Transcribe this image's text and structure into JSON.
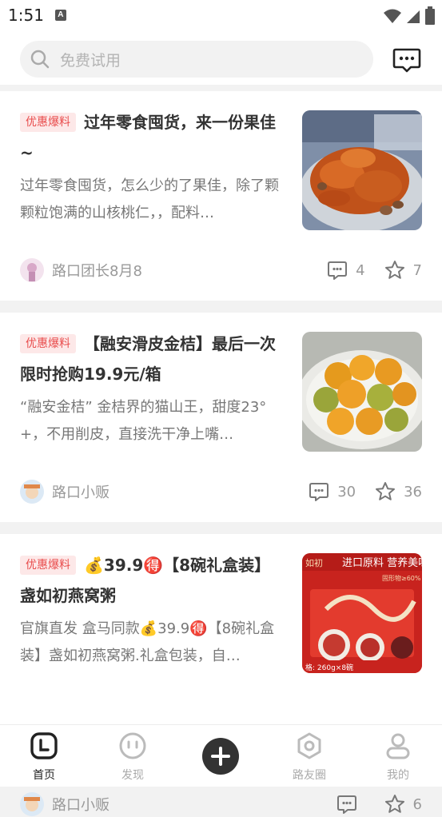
{
  "status_bar": {
    "time": "1:51",
    "notif_letter": "A"
  },
  "search": {
    "placeholder": "免费试用"
  },
  "feed": [
    {
      "tag": "优惠爆料",
      "title": "过年零食囤货，来一份果佳~",
      "desc": "过年零食囤货，怎么少的了果佳，除了颗颗粒饱满的山核桃仁，，配料…",
      "author": "路口团长8月8",
      "comments": "4",
      "likes": "7",
      "image": "dried-sweet-potato-snack-bowl"
    },
    {
      "tag": "优惠爆料",
      "title": "【融安滑皮金桔】最后一次限时抢购19.9元/箱",
      "desc": "“融安金桔” 金桔界的猫山王，甜度23°+，不用削皮，直接洗干净上嘴…",
      "author": "路口小贩",
      "comments": "30",
      "likes": "36",
      "image": "kumquats-on-plate"
    },
    {
      "tag": "优惠爆料",
      "title": "💰39.9🉐【8碗礼盒装】盏如初燕窝粥",
      "desc": "官旗直发 盒马同款💰39.9🉐【8碗礼盒装】盏如初燕窝粥.礼盒包装，自…",
      "author": "路口小贩",
      "comments": "",
      "likes": "6",
      "image": "bird-nest-congee-gift-box",
      "image_text": {
        "top": "进口原料 营养美味",
        "brand": "如初",
        "sub": "固形物≥60%",
        "bottom": "格: 260g×8碗"
      }
    }
  ],
  "tabbar": {
    "tabs": [
      {
        "label": "首页",
        "icon": "home-icon",
        "active": true
      },
      {
        "label": "发现",
        "icon": "discover-icon",
        "active": false
      },
      {
        "label": "路友圈",
        "icon": "circle-icon",
        "active": false
      },
      {
        "label": "我的",
        "icon": "profile-icon",
        "active": false
      }
    ]
  },
  "colors": {
    "accent": "#e94d4d",
    "tag_bg": "#fde8e8",
    "active_tab": "#222222"
  }
}
